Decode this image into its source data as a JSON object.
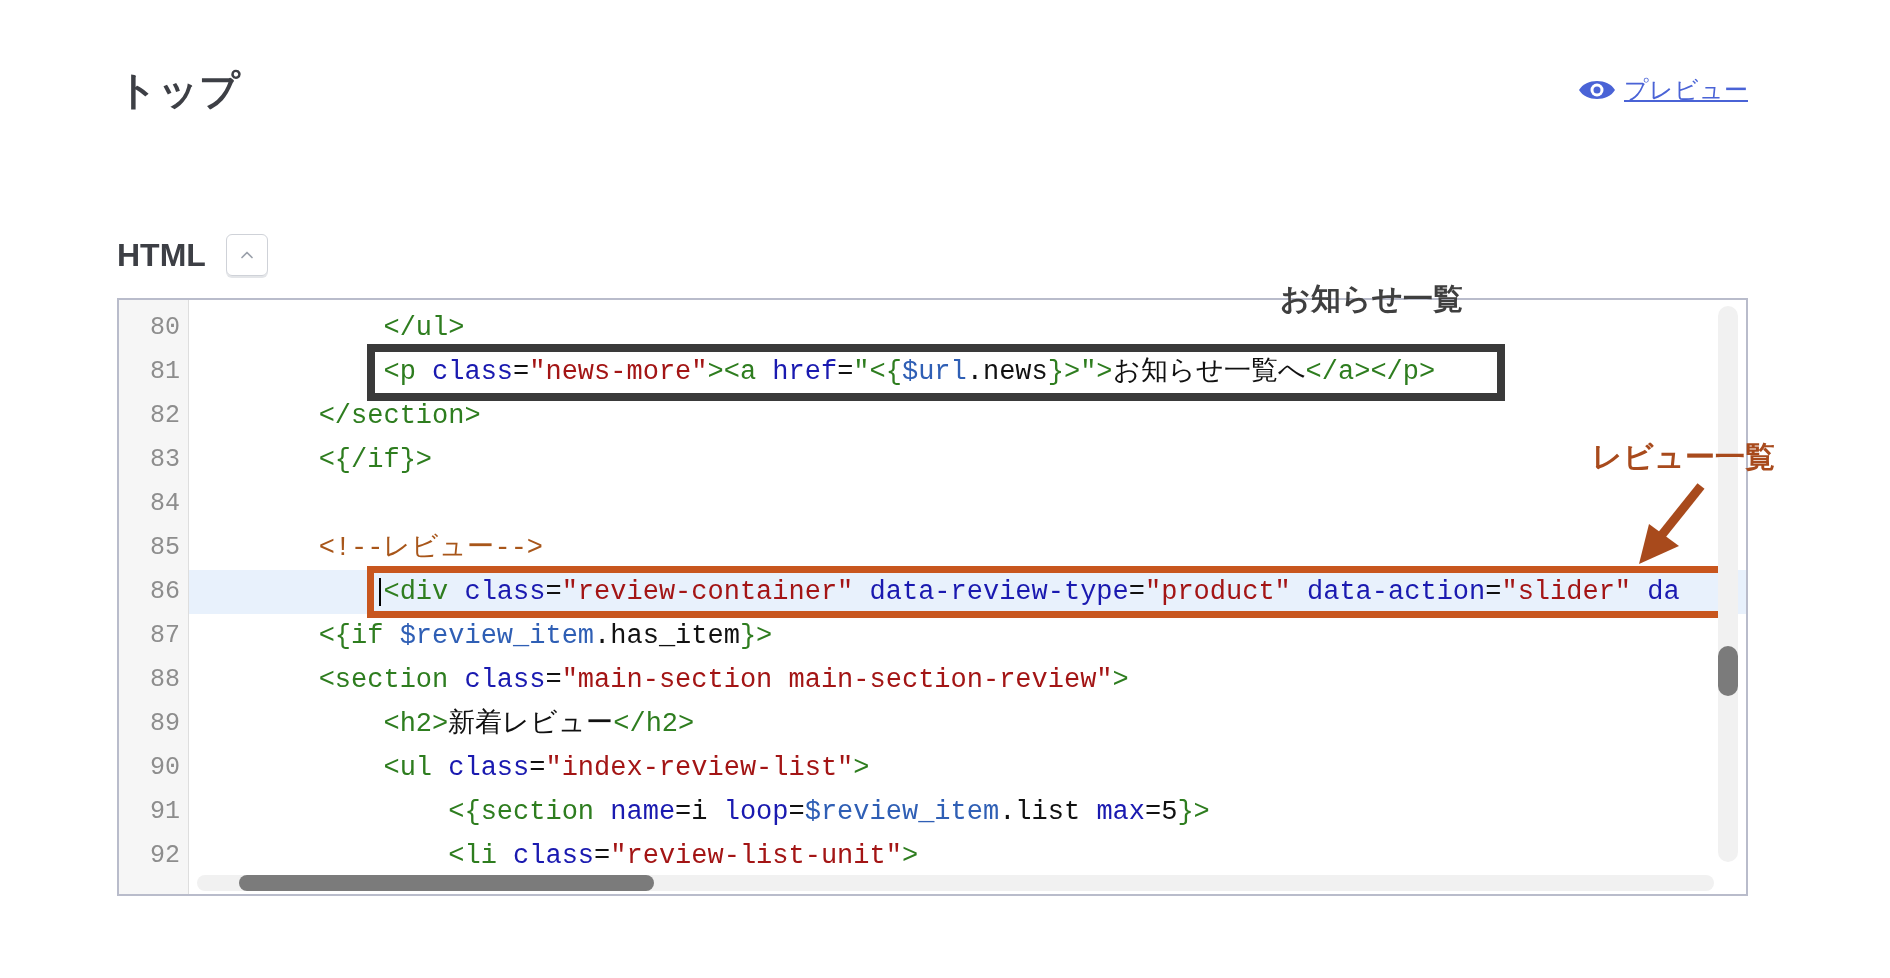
{
  "page_title": "トップ",
  "preview_link": {
    "label": "プレビュー"
  },
  "section": {
    "label": "HTML",
    "expanded": true
  },
  "editor": {
    "lines": [
      {
        "number": "80",
        "current": false,
        "tokens": [
          {
            "kind": "tag",
            "text": "            </ul>"
          }
        ]
      },
      {
        "number": "81",
        "current": false,
        "tokens": [
          {
            "kind": "tag",
            "text": "            <p "
          },
          {
            "kind": "attr",
            "text": "class"
          },
          {
            "kind": "text",
            "text": "="
          },
          {
            "kind": "string",
            "text": "\"news-more\""
          },
          {
            "kind": "tag",
            "text": "><a "
          },
          {
            "kind": "attr",
            "text": "href"
          },
          {
            "kind": "text",
            "text": "="
          },
          {
            "kind": "tag",
            "text": "\"<{"
          },
          {
            "kind": "var",
            "text": "$url"
          },
          {
            "kind": "text",
            "text": ".news"
          },
          {
            "kind": "tag",
            "text": "}>\">"
          },
          {
            "kind": "text",
            "text": "お知らせ一覧へ"
          },
          {
            "kind": "tag",
            "text": "</a></p>"
          }
        ]
      },
      {
        "number": "82",
        "current": false,
        "tokens": [
          {
            "kind": "tag",
            "text": "        </section>"
          }
        ]
      },
      {
        "number": "83",
        "current": false,
        "tokens": [
          {
            "kind": "tag",
            "text": "        <{/if}>"
          }
        ]
      },
      {
        "number": "84",
        "current": false
      },
      {
        "number": "85",
        "current": false,
        "tokens": [
          {
            "kind": "comment",
            "text": "        <!--レビュー-->"
          }
        ]
      },
      {
        "number": "86",
        "current": true,
        "tokens": [
          {
            "kind": "tag",
            "text": "            <div "
          },
          {
            "kind": "attr",
            "text": "class"
          },
          {
            "kind": "text",
            "text": "="
          },
          {
            "kind": "string",
            "text": "\"review-container\""
          },
          {
            "kind": "attr",
            "text": " data-review-type"
          },
          {
            "kind": "text",
            "text": "="
          },
          {
            "kind": "string",
            "text": "\"product\""
          },
          {
            "kind": "attr",
            "text": " data-action"
          },
          {
            "kind": "text",
            "text": "="
          },
          {
            "kind": "string",
            "text": "\"slider\""
          },
          {
            "kind": "attr",
            "text": " da"
          }
        ]
      },
      {
        "number": "87",
        "current": false,
        "tokens": [
          {
            "kind": "tag",
            "text": "        <{if "
          },
          {
            "kind": "var",
            "text": "$review_item"
          },
          {
            "kind": "text",
            "text": ".has_item"
          },
          {
            "kind": "tag",
            "text": "}>"
          }
        ]
      },
      {
        "number": "88",
        "current": false,
        "tokens": [
          {
            "kind": "tag",
            "text": "        <section "
          },
          {
            "kind": "attr",
            "text": "class"
          },
          {
            "kind": "text",
            "text": "="
          },
          {
            "kind": "string",
            "text": "\"main-section main-section-review\""
          },
          {
            "kind": "tag",
            "text": ">"
          }
        ]
      },
      {
        "number": "89",
        "current": false,
        "tokens": [
          {
            "kind": "tag",
            "text": "            <h2>"
          },
          {
            "kind": "text",
            "text": "新着レビュー"
          },
          {
            "kind": "tag",
            "text": "</h2>"
          }
        ]
      },
      {
        "number": "90",
        "current": false,
        "tokens": [
          {
            "kind": "tag",
            "text": "            <ul "
          },
          {
            "kind": "attr",
            "text": "class"
          },
          {
            "kind": "text",
            "text": "="
          },
          {
            "kind": "string",
            "text": "\"index-review-list\""
          },
          {
            "kind": "tag",
            "text": ">"
          }
        ]
      },
      {
        "number": "91",
        "current": false,
        "tokens": [
          {
            "kind": "tag",
            "text": "                <{section "
          },
          {
            "kind": "attr",
            "text": "name"
          },
          {
            "kind": "text",
            "text": "=i "
          },
          {
            "kind": "attr",
            "text": "loop"
          },
          {
            "kind": "text",
            "text": "="
          },
          {
            "kind": "var",
            "text": "$review_item"
          },
          {
            "kind": "text",
            "text": ".list "
          },
          {
            "kind": "attr",
            "text": "max"
          },
          {
            "kind": "text",
            "text": "=5"
          },
          {
            "kind": "tag",
            "text": "}>"
          }
        ]
      },
      {
        "number": "92",
        "current": false,
        "tokens": [
          {
            "kind": "tag",
            "text": "                <li "
          },
          {
            "kind": "attr",
            "text": "class"
          },
          {
            "kind": "text",
            "text": "="
          },
          {
            "kind": "string",
            "text": "\"review-list-unit\""
          },
          {
            "kind": "tag",
            "text": ">"
          }
        ]
      }
    ]
  },
  "annotations": [
    {
      "label": "お知らせ一覧",
      "kind": "dark"
    },
    {
      "label": "レビュー一覧",
      "kind": "orange"
    }
  ]
}
